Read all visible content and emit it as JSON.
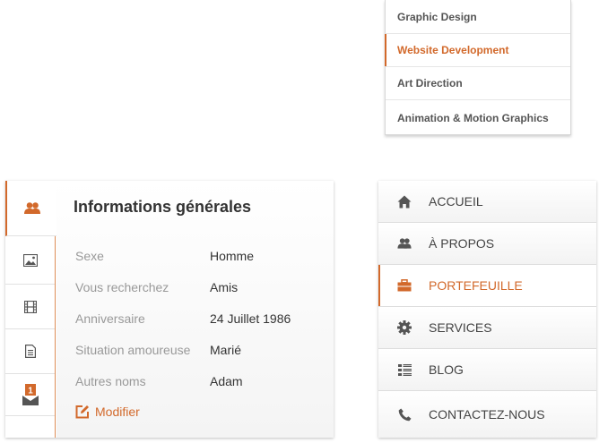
{
  "dropdown": {
    "items": [
      {
        "label": "Graphic Design"
      },
      {
        "label": "Website Development"
      },
      {
        "label": "Art Direction"
      },
      {
        "label": "Animation & Motion Graphics"
      }
    ],
    "active_index": 1
  },
  "profile": {
    "title": "Informations générales",
    "tabs": [
      {
        "icon": "people-icon",
        "active": true
      },
      {
        "icon": "image-icon"
      },
      {
        "icon": "film-icon"
      },
      {
        "icon": "document-icon"
      },
      {
        "icon": "mail-icon",
        "badge": "1"
      }
    ],
    "fields": [
      {
        "label": "Sexe",
        "value": "Homme"
      },
      {
        "label": "Vous recherchez",
        "value": "Amis"
      },
      {
        "label": "Anniversaire",
        "value": "24 Juillet 1986"
      },
      {
        "label": "Situation amoureuse",
        "value": "Marié"
      },
      {
        "label": "Autres noms",
        "value": "Adam"
      }
    ],
    "edit_label": "Modifier"
  },
  "nav": {
    "items": [
      {
        "label": "ACCUEIL",
        "icon": "home-icon"
      },
      {
        "label": "À PROPOS",
        "icon": "people-icon"
      },
      {
        "label": "PORTEFEUILLE",
        "icon": "briefcase-icon"
      },
      {
        "label": "SERVICES",
        "icon": "gear-icon"
      },
      {
        "label": "BLOG",
        "icon": "list-icon"
      },
      {
        "label": "CONTACTEZ-NOUS",
        "icon": "phone-icon"
      }
    ],
    "active_index": 2
  },
  "colors": {
    "accent": "#d2692b",
    "text": "#333333",
    "muted": "#999999"
  }
}
